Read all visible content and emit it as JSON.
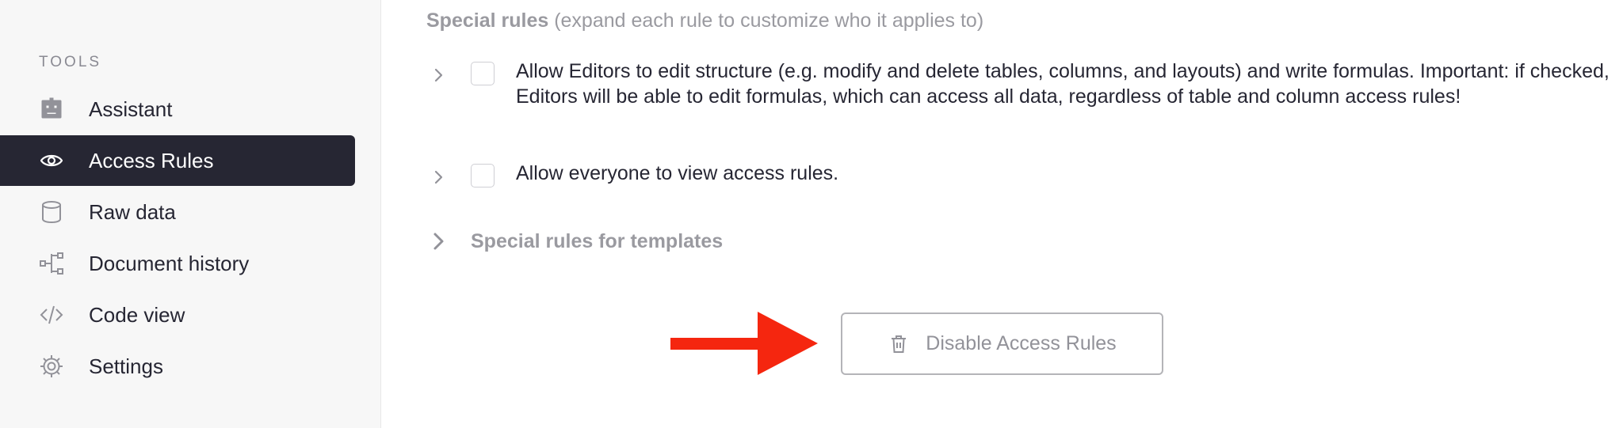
{
  "sidebar": {
    "section_title": "TOOLS",
    "items": [
      {
        "label": "Assistant",
        "icon": "robot-icon",
        "active": false
      },
      {
        "label": "Access Rules",
        "icon": "eye-icon",
        "active": true
      },
      {
        "label": "Raw data",
        "icon": "database-icon",
        "active": false
      },
      {
        "label": "Document history",
        "icon": "history-tree-icon",
        "active": false
      },
      {
        "label": "Code view",
        "icon": "code-icon",
        "active": false
      },
      {
        "label": "Settings",
        "icon": "gear-icon",
        "active": false
      }
    ]
  },
  "main": {
    "special_rules": {
      "title": "Special rules",
      "subtitle": "(expand each rule to customize who it applies to)",
      "rules": [
        {
          "text": "Allow Editors to edit structure (e.g. modify and delete tables, columns, and layouts) and write formulas. Important: if checked, Editors will be able to edit formulas, which can access all data, regardless of table and column access rules!",
          "checked": false
        },
        {
          "text": "Allow everyone to view access rules.",
          "checked": false
        }
      ]
    },
    "templates_section": {
      "label": "Special rules for templates"
    },
    "disable_button": {
      "label": "Disable Access Rules",
      "icon": "trash-icon"
    },
    "annotation": {
      "icon": "red-arrow-icon",
      "color": "#f5260f"
    }
  },
  "colors": {
    "sidebar_active_bg": "#262633",
    "muted_text": "#9a9aa0"
  }
}
